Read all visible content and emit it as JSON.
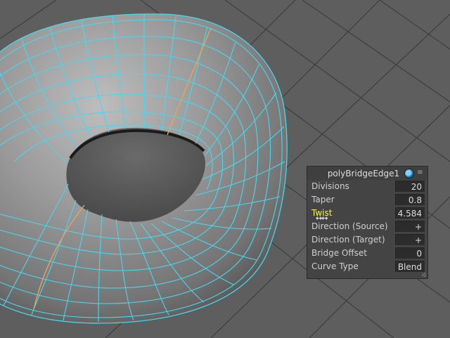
{
  "panel": {
    "title": "polyBridgeEdge1",
    "icons": [
      "sphere-icon",
      "menu-icon"
    ],
    "highlighted": "Twist",
    "rows": [
      {
        "label": "Divisions",
        "value": "20"
      },
      {
        "label": "Taper",
        "value": "0.8"
      },
      {
        "label": "Twist",
        "value": "4.584"
      },
      {
        "label": "Direction (Source)",
        "value": "+"
      },
      {
        "label": "Direction (Target)",
        "value": "+"
      },
      {
        "label": "Bridge Offset",
        "value": "0"
      },
      {
        "label": "Curve Type",
        "value": "Blend"
      }
    ]
  },
  "colors": {
    "background": "#5e5e5e",
    "grid": "#3e3e3e",
    "mesh_surface": "#8c8c8c",
    "wireframe": "#46d8ef",
    "edge_loop": "#e7a35d",
    "highlight_label": "#f3f35a"
  }
}
